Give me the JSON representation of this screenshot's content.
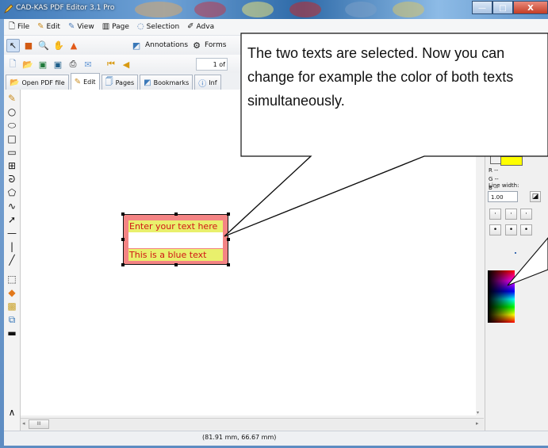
{
  "window": {
    "title": "CAD-KAS PDF Editor 3.1 Pro",
    "controls": {
      "minimize": "—",
      "maximize": "□",
      "close": "X"
    }
  },
  "menubar": {
    "items": [
      {
        "label": "File",
        "icon": "file-icon"
      },
      {
        "label": "Edit",
        "icon": "edit-icon"
      },
      {
        "label": "View",
        "icon": "view-icon"
      },
      {
        "label": "Page",
        "icon": "page-icon"
      },
      {
        "label": "Selection",
        "icon": "selection-icon"
      },
      {
        "label": "Adva",
        "icon": "advanced-icon"
      }
    ]
  },
  "toolbar2": {
    "annotations_label": "Annotations",
    "forms_label": "Forms"
  },
  "toolbar3": {
    "page_counter": "1 of"
  },
  "tabs": [
    {
      "label": "Open PDF file",
      "icon": "open-file-icon"
    },
    {
      "label": "Edit",
      "icon": "pencil-icon"
    },
    {
      "label": "Pages",
      "icon": "pages-icon"
    },
    {
      "label": "Bookmarks",
      "icon": "bookmark-icon"
    },
    {
      "label": "Inf",
      "icon": "info-icon"
    }
  ],
  "right_panel": {
    "r_label": "R --",
    "g_label": "G --",
    "b_label": "B --",
    "line_width_label": "Line width:",
    "line_width_value": "1.00",
    "selected_color": "#ffff00"
  },
  "document": {
    "text1": "Enter your text here",
    "text2": "This is a blue text",
    "text_color": "#d01515",
    "highlight_color": "#e9f06c",
    "selection_fill": "#f27373"
  },
  "callout": {
    "line1": "The two texts are selected. Now you can",
    "line2": "change for example the color of both texts",
    "line3": "simultaneously."
  },
  "status": {
    "coordinates": "(81.91 mm, 66.67 mm)"
  },
  "scrollbar": {
    "thumb_glyph": "III"
  }
}
